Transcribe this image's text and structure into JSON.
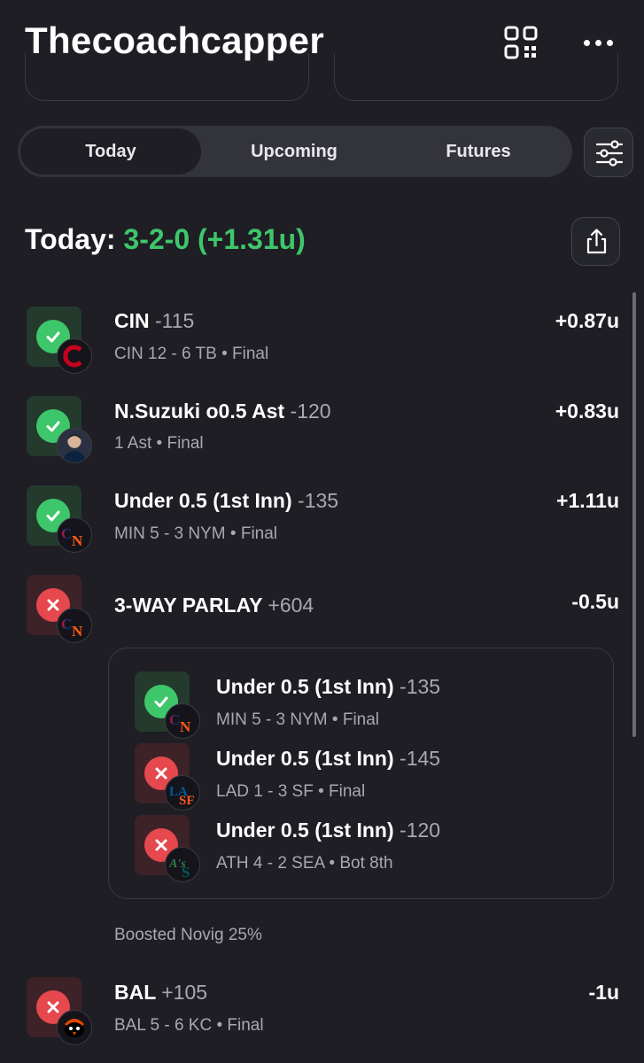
{
  "header": {
    "title": "Thecoachcapper"
  },
  "tabs": [
    {
      "label": "Today",
      "active": true
    },
    {
      "label": "Upcoming",
      "active": false
    },
    {
      "label": "Futures",
      "active": false
    }
  ],
  "summary": {
    "label": "Today:",
    "record": "3-2-0 (+1.31u)"
  },
  "bets": [
    {
      "status": "win",
      "logo": "cincinnati-reds-logo-icon",
      "title": "CIN",
      "odds": "-115",
      "sub": "CIN 12 - 6 TB • Final",
      "result": "+0.87u"
    },
    {
      "status": "win",
      "logo": "player-avatar-icon",
      "title": "N.Suzuki o0.5 Ast",
      "odds": "-120",
      "sub": "1 Ast • Final",
      "result": "+0.83u"
    },
    {
      "status": "win",
      "logo": "twins-mets-logo-icon",
      "title": "Under 0.5 (1st Inn)",
      "odds": "-135",
      "sub": "MIN 5 - 3 NYM • Final",
      "result": "+1.11u"
    },
    {
      "status": "loss",
      "logo": "twins-mets-logo-icon",
      "title": "3-WAY PARLAY",
      "odds": "+604",
      "sub": "",
      "result": "-0.5u"
    }
  ],
  "parlay_legs": [
    {
      "status": "win",
      "logo": "twins-mets-logo-icon",
      "title": "Under 0.5 (1st Inn)",
      "odds": "-135",
      "sub": "MIN 5 - 3 NYM • Final"
    },
    {
      "status": "loss",
      "logo": "dodgers-giants-logo-icon",
      "title": "Under 0.5 (1st Inn)",
      "odds": "-145",
      "sub": "LAD 1 - 3 SF • Final"
    },
    {
      "status": "loss",
      "logo": "athletics-mariners-logo-icon",
      "title": "Under 0.5 (1st Inn)",
      "odds": "-120",
      "sub": "ATH 4 - 2 SEA • Bot 8th"
    }
  ],
  "parlay_note": "Boosted Novig 25%",
  "last_bet": {
    "status": "loss",
    "logo": "orioles-logo-icon",
    "title": "BAL",
    "odds": "+105",
    "sub": "BAL 5 - 6 KC • Final",
    "result": "-1u"
  },
  "colors": {
    "background": "#1e1e24",
    "win": "#3ec66b",
    "loss": "#e5484d",
    "muted": "#a8a8b0"
  }
}
